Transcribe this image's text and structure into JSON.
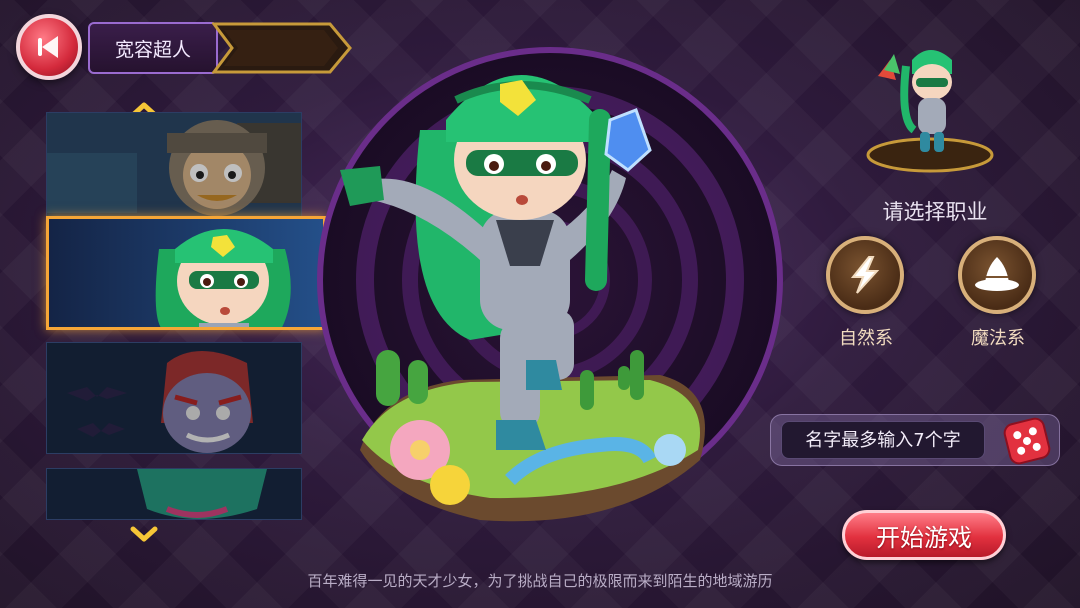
{
  "header": {
    "title": "宽容超人"
  },
  "hero_list": {
    "cards": [
      {
        "name": "hero-card-1",
        "theme": "#2f4a66"
      },
      {
        "name": "hero-card-2",
        "theme": "#1e3a6a"
      },
      {
        "name": "hero-card-3",
        "theme": "#1a2c48"
      },
      {
        "name": "hero-card-4",
        "theme": "#1a2c48"
      }
    ],
    "selected_index": 1
  },
  "class_select": {
    "prompt": "请选择职业",
    "options": [
      {
        "label": "自然系",
        "icon": "lightning-icon"
      },
      {
        "label": "魔法系",
        "icon": "wizard-hat-icon"
      }
    ]
  },
  "name_field": {
    "placeholder": "名字最多输入7个字",
    "value": ""
  },
  "start_button": {
    "label": "开始游戏"
  },
  "description": "百年难得一见的天才少女，为了挑战自己的极限而来到陌生的地域游历",
  "colors": {
    "accent_gold": "#f6a637",
    "start_red": "#e2313f",
    "hero_green": "#21b66a"
  }
}
